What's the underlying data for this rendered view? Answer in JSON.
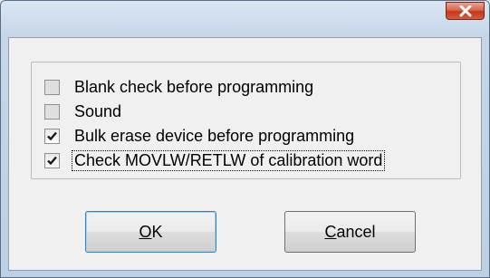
{
  "window": {
    "close_icon": "close-icon"
  },
  "options": [
    {
      "label": "Blank check before programming",
      "checked": false
    },
    {
      "label": "Sound",
      "checked": false
    },
    {
      "label": "Bulk erase device before programming",
      "checked": true
    },
    {
      "label": "Check MOVLW/RETLW of calibration word",
      "checked": true
    }
  ],
  "buttons": {
    "ok": {
      "mnemonic": "O",
      "rest": "K"
    },
    "cancel": {
      "mnemonic": "C",
      "rest": "ancel"
    }
  },
  "colors": {
    "close_button": "#c4381d",
    "frame": "#c6d6e8",
    "client": "#f0f0f0"
  }
}
